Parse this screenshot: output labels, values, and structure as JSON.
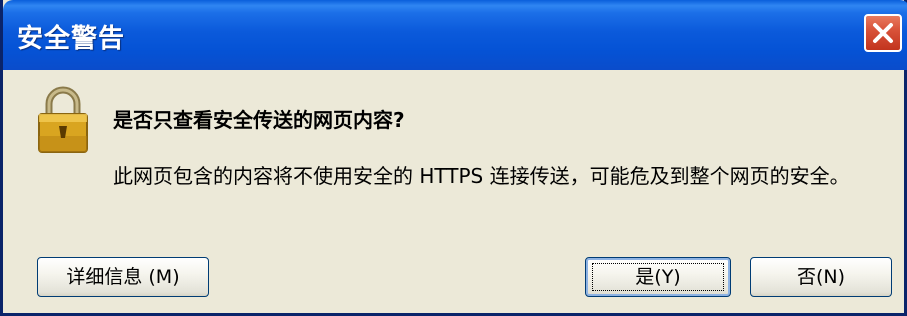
{
  "window": {
    "title": "安全警告"
  },
  "dialog": {
    "question": "是否只查看安全传送的网页内容?",
    "message": "此网页包含的内容将不使用安全的 HTTPS 连接传送，可能危及到整个网页的安全。"
  },
  "buttons": {
    "details_label": "详细信息 (M)",
    "yes_label": "是(Y)",
    "no_label": "否(N)"
  },
  "icons": {
    "title_close": "close-icon",
    "dialog": "padlock-warning-icon"
  },
  "colors": {
    "titlebar": "#0553D6",
    "dialog_background": "#ECE9D8",
    "close_button": "#D9533A",
    "button_border": "#003C74"
  }
}
